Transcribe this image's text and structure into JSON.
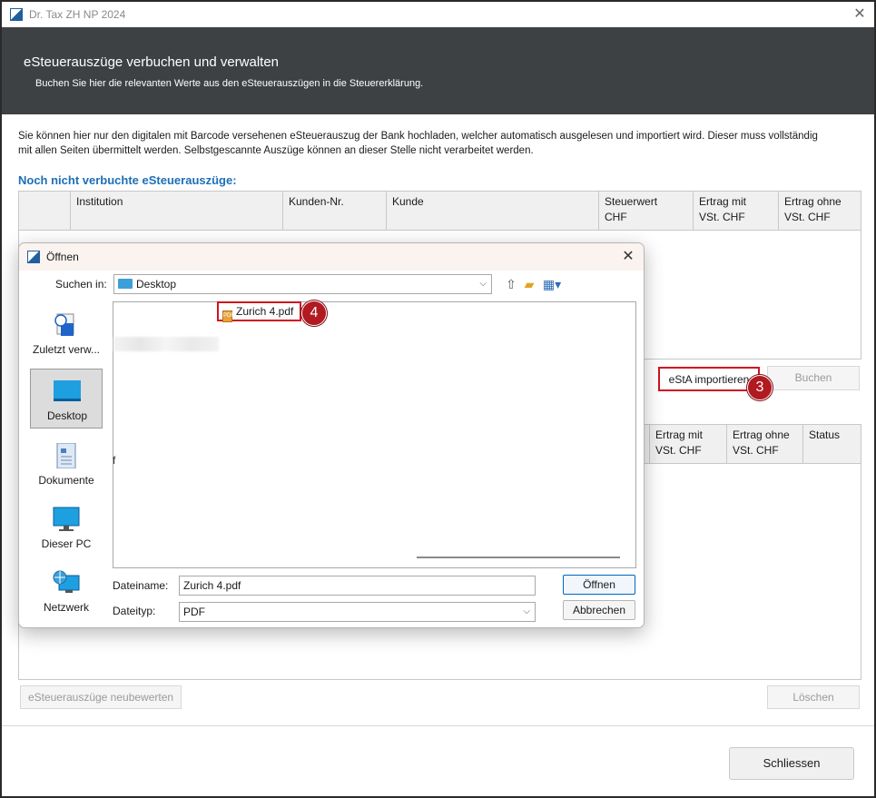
{
  "app": {
    "title": "Dr. Tax ZH NP 2024",
    "close_icon": "close-icon"
  },
  "banner": {
    "title": "eSteuerauszüge verbuchen und verwalten",
    "subtitle": "Buchen Sie hier die relevanten Werte aus den eSteuerauszügen in die Steuererklärung."
  },
  "intro": {
    "line1": "Sie können hier nur den digitalen mit Barcode versehenen eSteuerauszug der Bank hochladen, welcher automatisch ausgelesen und importiert wird. Dieser muss vollständig",
    "line2": "mit allen Seiten übermittelt werden. Selbstgescannte Auszüge können an dieser Stelle nicht verarbeitet werden."
  },
  "pending": {
    "title": "Noch nicht verbuchte eSteuerauszüge:",
    "columns": {
      "institution": "Institution",
      "customer_no": "Kunden-Nr.",
      "customer": "Kunde",
      "tax_value_1": "Steuerwert",
      "tax_value_2": "CHF",
      "income_with_1": "Ertrag mit",
      "income_with_2": "VSt. CHF",
      "income_without_1": "Ertrag ohne",
      "income_without_2": "VSt. CHF"
    }
  },
  "booked": {
    "columns": {
      "income_with_1": "Ertrag mit",
      "income_with_2": "VSt. CHF",
      "income_without_1": "Ertrag ohne",
      "income_without_2": "VSt. CHF",
      "status": "Status"
    }
  },
  "buttons": {
    "import": "eStA importieren",
    "book": "Buchen",
    "revaluate": "eSteuerauszüge neubewerten",
    "delete": "Löschen",
    "close": "Schliessen"
  },
  "markers": {
    "import_step": "3",
    "file_step": "4"
  },
  "dialog": {
    "title": "Öffnen",
    "look_in_label": "Suchen in:",
    "look_in_value": "Desktop",
    "places": [
      {
        "label": "Zuletzt verw...",
        "icon": "recent-icon"
      },
      {
        "label": "Desktop",
        "icon": "desktop-icon"
      },
      {
        "label": "Dokumente",
        "icon": "documents-icon"
      },
      {
        "label": "Dieser PC",
        "icon": "computer-icon"
      },
      {
        "label": "Netzwerk",
        "icon": "network-icon"
      }
    ],
    "files": [
      {
        "name": "Zurich 4.pdf",
        "icon": "pdf-icon"
      }
    ],
    "stray_text": "f",
    "filename_label": "Dateiname:",
    "filename_value": "Zurich 4.pdf",
    "filetype_label": "Dateityp:",
    "filetype_value": "PDF",
    "open_button": "Öffnen",
    "cancel_button": "Abbrechen"
  },
  "colors": {
    "banner_bg": "#3e4144",
    "section_title": "#1d6fb8",
    "highlight_red": "#d0131f",
    "marker_red": "#b11a21"
  }
}
